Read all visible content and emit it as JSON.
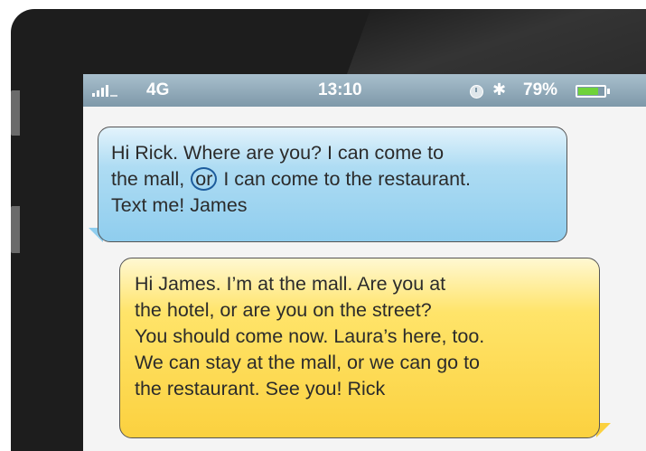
{
  "status_bar": {
    "network": "4G",
    "time": "13:10",
    "battery_percent": "79%",
    "battery_level": 0.79,
    "icons": [
      "signal-icon",
      "alarm-icon",
      "bluetooth-icon",
      "battery-icon"
    ]
  },
  "messages": [
    {
      "sender": "James",
      "color": "#8fcdee",
      "lines": [
        {
          "before": "Hi Rick. Where are you? I can come to",
          "highlight": "",
          "after": ""
        },
        {
          "before": "the mall, ",
          "highlight": "or",
          "after": " I can come to the restaurant."
        },
        {
          "before": "Text me! James",
          "highlight": "",
          "after": ""
        }
      ]
    },
    {
      "sender": "Rick",
      "color": "#fbd13f",
      "lines": [
        "Hi James. I’m at the mall. Are you at",
        "the hotel, or are you on the street?",
        "You should come now. Laura’s here, too.",
        "We can stay at the mall, or we can go to",
        "the restaurant. See you! Rick"
      ]
    }
  ]
}
